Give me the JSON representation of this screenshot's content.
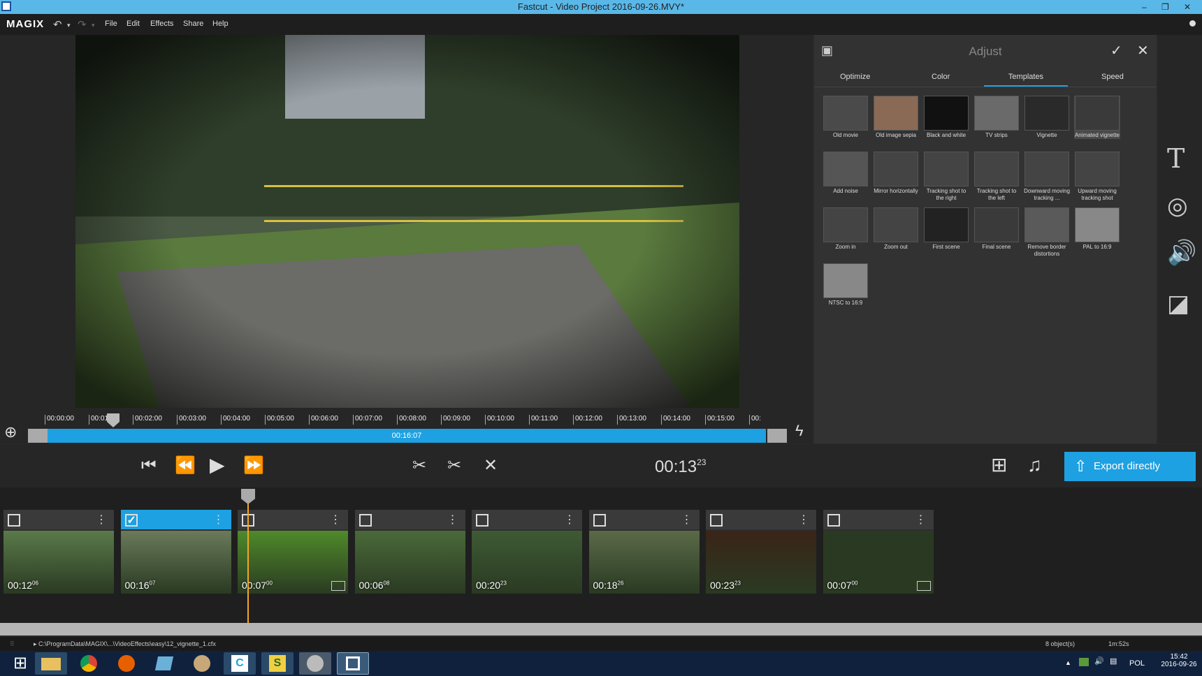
{
  "window": {
    "title": "Fastcut - Video Project 2016-09-26.MVY*"
  },
  "menu": {
    "logo": "MAGIX",
    "items": [
      "File",
      "Edit",
      "Effects",
      "Share",
      "Help"
    ]
  },
  "ruler": {
    "ticks": [
      "00:00:00",
      "00:01:00",
      "00:02:00",
      "00:03:00",
      "00:04:00",
      "00:05:00",
      "00:06:00",
      "00:07:00",
      "00:08:00",
      "00:09:00",
      "00:10:00",
      "00:11:00",
      "00:12:00",
      "00:13:00",
      "00:14:00",
      "00:15:00",
      "00:"
    ]
  },
  "bar": {
    "duration": "00:16:07"
  },
  "timecode": {
    "main": "00:13",
    "frames": "23"
  },
  "export": {
    "label": "Export directly"
  },
  "panel": {
    "title": "Adjust",
    "tabs": [
      "Optimize",
      "Color",
      "Templates",
      "Speed"
    ],
    "active_tab": "Templates",
    "templates": [
      {
        "label": "Old movie",
        "color": "#4a4a4a"
      },
      {
        "label": "Old image sepia",
        "color": "#8a6a55"
      },
      {
        "label": "Black and white",
        "color": "#111111"
      },
      {
        "label": "TV strips",
        "color": "#6a6a6a"
      },
      {
        "label": "Vignette",
        "color": "#2a2a2a"
      },
      {
        "label": "Animated vignette",
        "color": "#3a3a3a"
      },
      {
        "label": "Add noise",
        "color": "#555555"
      },
      {
        "label": "Mirror horizontally",
        "color": "#444444"
      },
      {
        "label": "Tracking shot to the right",
        "color": "#444444"
      },
      {
        "label": "Tracking shot to the left",
        "color": "#444444"
      },
      {
        "label": "Downward moving tracking ...",
        "color": "#444444"
      },
      {
        "label": "Upward moving tracking shot",
        "color": "#444444"
      },
      {
        "label": "Zoom in",
        "color": "#444444"
      },
      {
        "label": "Zoom out",
        "color": "#444444"
      },
      {
        "label": "First scene",
        "color": "#222222"
      },
      {
        "label": "Final scene",
        "color": "#3a3a3a"
      },
      {
        "label": "Remove border distortions",
        "color": "#5a5a5a"
      },
      {
        "label": "PAL to 16:9",
        "color": "#888888"
      },
      {
        "label": "NTSC to 16:9",
        "color": "#888888"
      }
    ]
  },
  "clips": [
    {
      "dur": "00:12",
      "fr": "06",
      "selected": false,
      "color": "#5a7a4a"
    },
    {
      "dur": "00:16",
      "fr": "07",
      "selected": true,
      "color": "#6a7a5a"
    },
    {
      "dur": "00:07",
      "fr": "00",
      "selected": false,
      "color": "#4f8a2a"
    },
    {
      "dur": "00:06",
      "fr": "08",
      "selected": false,
      "color": "#4a6a3a"
    },
    {
      "dur": "00:20",
      "fr": "23",
      "selected": false,
      "color": "#3e5a34"
    },
    {
      "dur": "00:18",
      "fr": "26",
      "selected": false,
      "color": "#5a6a48"
    },
    {
      "dur": "00:23",
      "fr": "23",
      "selected": false,
      "color": "#3a2418"
    },
    {
      "dur": "00:07",
      "fr": "00",
      "selected": false,
      "color": "#2a3a22"
    }
  ],
  "status": {
    "path": "C:\\ProgramData\\MAGIX\\...\\VideoEffects\\easy\\12_vignette_1.cfx",
    "objects": "8 object(s)",
    "total": "1m:52s"
  },
  "taskbar": {
    "lang": "POL",
    "time": "15:42",
    "date": "2016-09-26"
  }
}
